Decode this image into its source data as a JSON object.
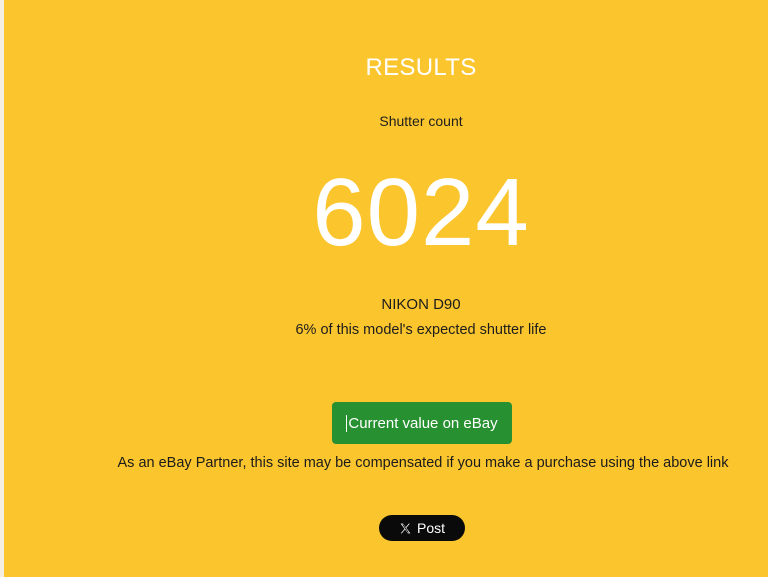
{
  "results": {
    "title": "RESULTS",
    "shutter_label": "Shutter count",
    "count": "6024",
    "model": "NIKON D90",
    "life_text": "6% of this model's expected shutter life"
  },
  "ebay": {
    "button_label": "Current value on eBay",
    "partner_note": "As an eBay Partner, this site may be compensated if you make a purchase using the above link"
  },
  "share": {
    "post_label": "Post",
    "icon": "x-logo-icon"
  },
  "colors": {
    "background": "#fbc52e",
    "button_green": "#279132",
    "post_black": "#0a0a0a"
  }
}
